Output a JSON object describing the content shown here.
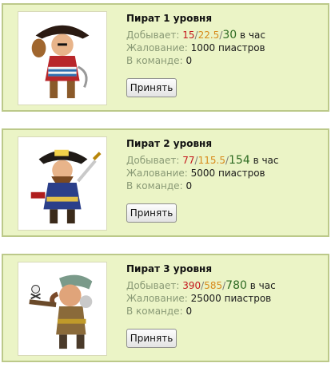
{
  "labels": {
    "mining": "Добывает:",
    "per_hour": "в час",
    "salary": "Жалование:",
    "in_team": "В команде:",
    "currency": "пиастров",
    "slash": "/"
  },
  "pirates": [
    {
      "title": "Пират 1 уровня",
      "m1": "15",
      "m2": "22.5",
      "m3": "30",
      "salary": "1000",
      "team": "0",
      "button": "Принять"
    },
    {
      "title": "Пират 2 уровня",
      "m1": "77",
      "m2": "115.5",
      "m3": "154",
      "salary": "5000",
      "team": "0",
      "button": "Принять"
    },
    {
      "title": "Пират 3 уровня",
      "m1": "390",
      "m2": "585",
      "m3": "780",
      "salary": "25000",
      "team": "0",
      "button": "Принять"
    }
  ],
  "colors": {
    "card_bg": "#ebf4c6",
    "card_border": "#bcc98a",
    "label": "#8a9a76",
    "value_low": "#c4161c",
    "value_mid": "#d88a1b",
    "value_high": "#2e6b23"
  }
}
